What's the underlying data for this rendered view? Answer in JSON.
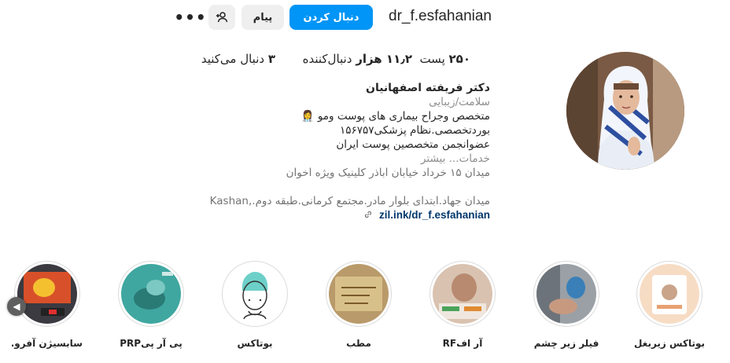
{
  "header": {
    "username": "dr_f.esfahanian",
    "follow_label": "دنبال کردن",
    "message_label": "پیام",
    "more_label": "•••"
  },
  "stats": {
    "posts_num": "۲۵۰",
    "posts_label": "پست",
    "followers_num": "۱۱٫۲ هزار",
    "followers_label": "دنبال‌کننده",
    "following_num": "۳",
    "following_label": "دنبال می‌کنید"
  },
  "bio": {
    "name": "دکتر فریفته اصفهانیان",
    "category": "سلامت/زیبایی",
    "line1": "متخصص وجراح بیماری های پوست ومو 👩‍⚕️",
    "line2": "بوردتخصصی.نظام پزشکی۱۵۶۷۵۷",
    "line3": "عضوانجمن متخصصین پوست ایران",
    "more": "خدمات... بیشتر",
    "address1": "میدان ۱۵ خرداد خیابان اباذر کلینیک ویژه اخوان",
    "address2": "میدان جهاد.ابتدای بلوار مادر.مجتمع کرمانی.طبقه دوم.,Kashan",
    "link": "zil.ink/dr_f.esfahanian"
  },
  "highlights": [
    {
      "label": "بوتاکس زیربغل",
      "icon": "highlight-botox-underarm"
    },
    {
      "label": "فیلر زیر چشم",
      "icon": "highlight-filler"
    },
    {
      "label": "آر افRF",
      "icon": "highlight-rf"
    },
    {
      "label": "مطب",
      "icon": "highlight-clinic"
    },
    {
      "label": "بوتاکس",
      "icon": "highlight-botox"
    },
    {
      "label": "پی آر پیPRP",
      "icon": "highlight-prp"
    },
    {
      "label": "سابسیژن آفرو...",
      "icon": "highlight-subcision"
    }
  ],
  "colors": {
    "accent": "#0095f6",
    "secondary_button": "#efefef",
    "link": "#00376b",
    "muted": "#8e8e8e"
  }
}
